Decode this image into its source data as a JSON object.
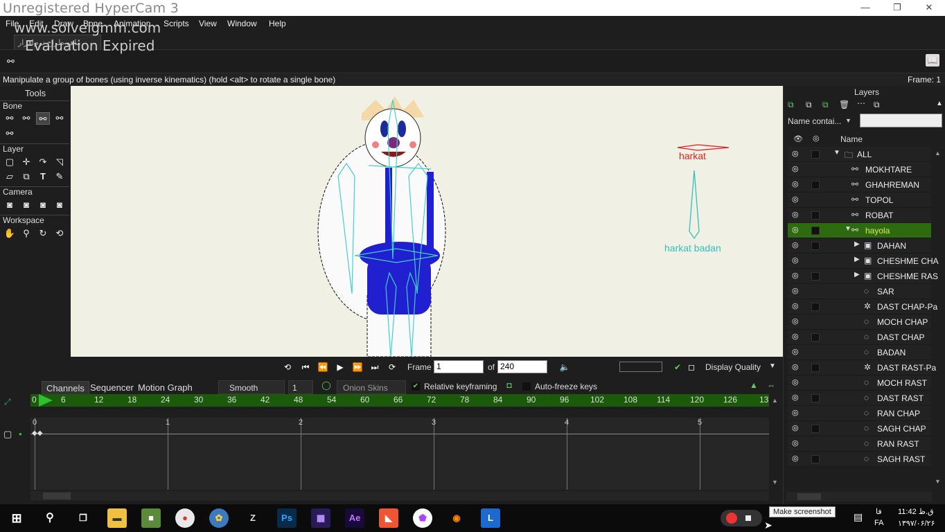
{
  "window": {
    "title": "Unregistered HyperCam 3",
    "controls": {
      "minimize": "—",
      "maximize": "❐",
      "close": "✕"
    }
  },
  "watermark": {
    "line1": "www.solveigmm.com",
    "line2": "Evaluation Expired"
  },
  "menu": {
    "file": "File",
    "edit": "Edit",
    "draw": "Draw",
    "bone": "Bone",
    "animation": "Animation",
    "scripts": "Scripts",
    "view": "View",
    "window": "Window",
    "help": "Help"
  },
  "doc_tab": {
    "label": "ماهو طراح نرم‌افزار"
  },
  "status": {
    "text": "Manipulate a group of bones (using inverse kinematics) (hold <alt> to rotate a single bone)",
    "frame": "Frame: 1"
  },
  "tools": {
    "title": "Tools",
    "sections": {
      "bone": "Bone",
      "layer": "Layer",
      "camera": "Camera",
      "workspace": "Workspace"
    }
  },
  "canvas": {
    "label1": "harkat",
    "label2": "harkat badan"
  },
  "playback": {
    "frame_label": "Frame",
    "frame_value": "1",
    "of_label": "of",
    "total_value": "240",
    "display_quality": "Display Quality"
  },
  "timeline": {
    "tabs": {
      "channels": "Channels",
      "sequencer": "Sequencer",
      "motion_graph": "Motion Graph"
    },
    "interp": "Smooth",
    "step": "1",
    "onion": "Onion Skins",
    "relative": "Relative keyframing",
    "autofreeze": "Auto-freeze keys",
    "ruler_ticks": [
      "0",
      "6",
      "12",
      "18",
      "24",
      "30",
      "36",
      "42",
      "48",
      "54",
      "60",
      "66",
      "72",
      "78",
      "84",
      "90",
      "96",
      "102",
      "108",
      "114",
      "120",
      "126",
      "13"
    ],
    "seconds": [
      "0",
      "1",
      "2",
      "3",
      "4",
      "5"
    ]
  },
  "layers": {
    "title": "Layers",
    "filter": "Name contai...",
    "col_name": "Name",
    "rows": [
      {
        "name": "ALL",
        "icon": "folder-icon",
        "indent": 0,
        "expand": "▼"
      },
      {
        "name": "MOKHTARE",
        "icon": "bone-icon",
        "indent": 1,
        "expand": ""
      },
      {
        "name": "GHAHREMAN",
        "icon": "bone-icon",
        "indent": 1,
        "expand": ""
      },
      {
        "name": "TOPOL",
        "icon": "bone-icon",
        "indent": 1,
        "expand": ""
      },
      {
        "name": "ROBAT",
        "icon": "bone-icon",
        "indent": 1,
        "expand": ""
      },
      {
        "name": "hayola",
        "icon": "bone-group-icon",
        "indent": 1,
        "expand": "▼"
      },
      {
        "name": "DAHAN",
        "icon": "image-group-icon",
        "indent": 2,
        "expand": "▶"
      },
      {
        "name": "CHESHME CHA",
        "icon": "image-group-icon",
        "indent": 2,
        "expand": "▶"
      },
      {
        "name": "CHESHME RAS",
        "icon": "image-group-icon",
        "indent": 2,
        "expand": "▶"
      },
      {
        "name": "SAR",
        "icon": "vector-icon",
        "indent": 2,
        "expand": ""
      },
      {
        "name": "DAST CHAP-Pa",
        "icon": "particle-icon",
        "indent": 2,
        "expand": ""
      },
      {
        "name": "MOCH CHAP",
        "icon": "vector-icon",
        "indent": 2,
        "expand": ""
      },
      {
        "name": "DAST CHAP",
        "icon": "vector-icon",
        "indent": 2,
        "expand": ""
      },
      {
        "name": "BADAN",
        "icon": "vector-icon",
        "indent": 2,
        "expand": ""
      },
      {
        "name": "DAST RAST-Pa",
        "icon": "particle-icon",
        "indent": 2,
        "expand": ""
      },
      {
        "name": "MOCH RAST",
        "icon": "vector-icon",
        "indent": 2,
        "expand": ""
      },
      {
        "name": "DAST RAST",
        "icon": "vector-icon",
        "indent": 2,
        "expand": ""
      },
      {
        "name": "RAN CHAP",
        "icon": "vector-icon",
        "indent": 2,
        "expand": ""
      },
      {
        "name": "SAGH CHAP",
        "icon": "vector-icon",
        "indent": 2,
        "expand": ""
      },
      {
        "name": "RAN RAST",
        "icon": "vector-icon",
        "indent": 2,
        "expand": ""
      },
      {
        "name": "SAGH RAST",
        "icon": "vector-icon",
        "indent": 2,
        "expand": ""
      }
    ]
  },
  "taskbar": {
    "tooltip": "Make screenshot",
    "lang": "FA",
    "lang2": "فا",
    "time": "11:42 ق.ظ",
    "date": "۱۳۹۷/۰۶/۲۶",
    "apps": [
      "Ps",
      "Ae"
    ]
  },
  "colors": {
    "selected_layer": "#2e6b10",
    "ruler": "#1a5a0a",
    "bone": "#40d0d0",
    "label_red": "#e02020",
    "label_cyan": "#30c0c0"
  }
}
